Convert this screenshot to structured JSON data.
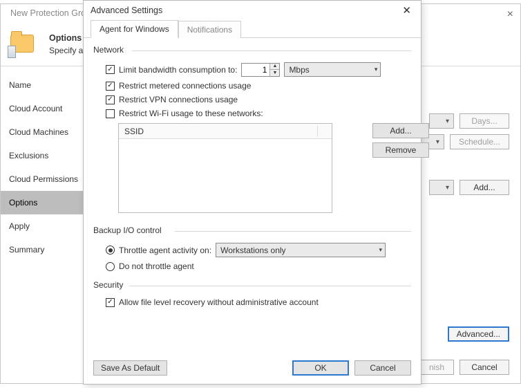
{
  "wizard": {
    "title": "New Protection Group",
    "heading": "Options",
    "sub": "Specify a",
    "nav": [
      "Name",
      "Cloud Account",
      "Cloud Machines",
      "Exclusions",
      "Cloud Permissions",
      "Options",
      "Apply",
      "Summary"
    ],
    "active_index": 5,
    "buttons": {
      "days": "Days...",
      "schedule": "Schedule...",
      "add": "Add...",
      "advanced": "Advanced...",
      "finish": "nish",
      "cancel": "Cancel"
    }
  },
  "dialog": {
    "title": "Advanced Settings",
    "tabs": [
      "Agent for Windows",
      "Notifications"
    ],
    "active_tab": 0,
    "network": {
      "group": "Network",
      "limit_bw_label": "Limit bandwidth consumption to:",
      "limit_bw_value": "1",
      "limit_bw_unit": "Mbps",
      "metered_label": "Restrict metered connections usage",
      "vpn_label": "Restrict VPN connections usage",
      "wifi_label": "Restrict Wi-Fi usage to these networks:",
      "ssid_header": "SSID",
      "add_btn": "Add...",
      "remove_btn": "Remove"
    },
    "backup": {
      "group": "Backup I/O control",
      "throttle_label": "Throttle agent activity on:",
      "throttle_value": "Workstations only",
      "nothrottle_label": "Do not throttle agent"
    },
    "security": {
      "group": "Security",
      "allow_label": "Allow file level recovery without administrative account"
    },
    "footer": {
      "save_default": "Save As Default",
      "ok": "OK",
      "cancel": "Cancel"
    }
  }
}
